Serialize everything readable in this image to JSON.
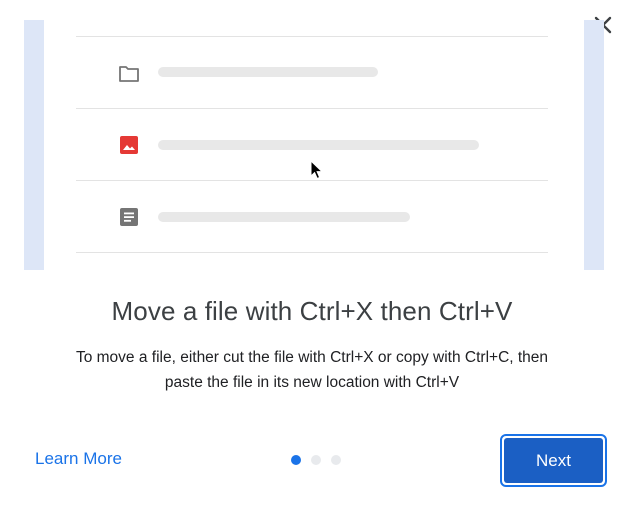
{
  "dialog": {
    "title": "Move a file with Ctrl+X then Ctrl+V",
    "description_line1": "To move a file, either cut the file with Ctrl+X or copy with Ctrl+C, then",
    "description_line2": "paste the file in its new location with Ctrl+V",
    "close_icon": "close-icon",
    "learn_more_label": "Learn More",
    "next_label": "Next",
    "pagination": {
      "total": 3,
      "current": 1
    }
  },
  "illustration": {
    "rows": [
      {
        "icon": "folder-icon"
      },
      {
        "icon": "image-icon"
      },
      {
        "icon": "document-icon"
      }
    ]
  },
  "colors": {
    "accent": "#1a73e8",
    "button": "#1b5fc4",
    "illustration_side": "#dde6f7",
    "image_icon": "#e53935",
    "dot_inactive": "#e8eaed"
  }
}
